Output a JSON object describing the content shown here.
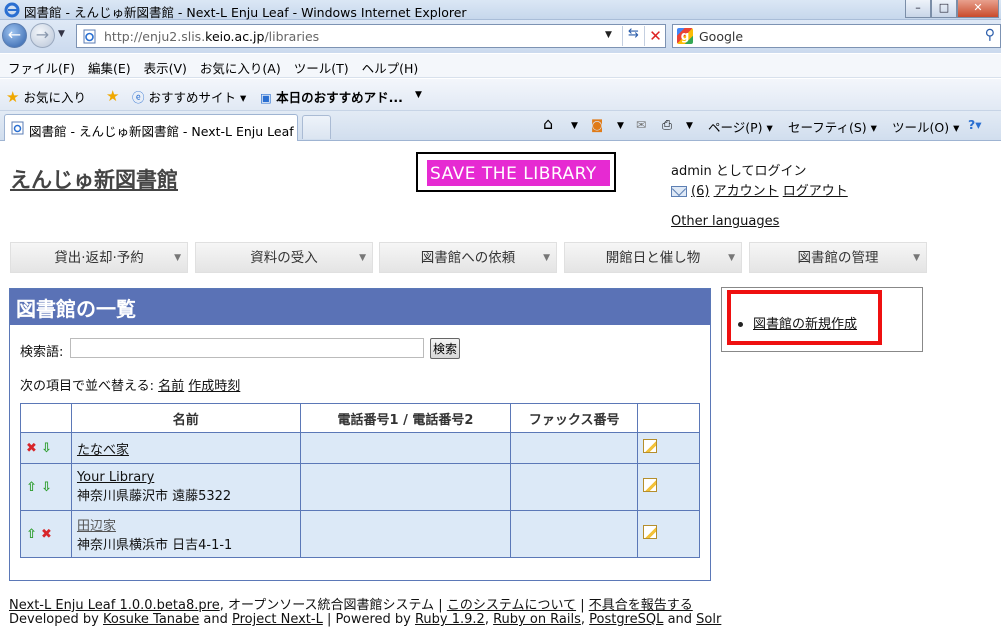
{
  "browser": {
    "window_title": "図書館 - えんじゅ新図書館 - Next-L Enju Leaf - Windows Internet Explorer",
    "url_prefix": "http://enju2.slis.",
    "url_host": "keio.ac.jp",
    "url_path": "/libraries",
    "search_provider": "Google",
    "menu": [
      "ファイル(F)",
      "編集(E)",
      "表示(V)",
      "お気に入り(A)",
      "ツール(T)",
      "ヘルプ(H)"
    ],
    "favorites_label": "お気に入り",
    "fav_sites": "おすすめサイト ▾",
    "fav_today": "本日のおすすめアド...",
    "tab_label": "図書館 - えんじゅ新図書館 - Next-L Enju Leaf",
    "cmd_page": "ページ(P) ▾",
    "cmd_safety": "セーフティ(S) ▾",
    "cmd_tools": "ツール(O) ▾"
  },
  "site": {
    "title": "えんじゅ新図書館",
    "banner": "SAVE THE LIBRARY",
    "login_text": "admin としてログイン",
    "messages": "(6)",
    "account": "アカウント",
    "logout": "ログアウト",
    "other_languages": "Other languages"
  },
  "nav": [
    {
      "label": "貸出·返却·予約"
    },
    {
      "label": "資料の受入"
    },
    {
      "label": "図書館への依頼"
    },
    {
      "label": "開館日と催し物"
    },
    {
      "label": "図書館の管理"
    }
  ],
  "main": {
    "heading": "図書館の一覧",
    "search_label": "検索語:",
    "search_value": "",
    "search_button": "検索",
    "sort_prefix": "次の項目で並べ替える:",
    "sort_name": "名前",
    "sort_created": "作成時刻",
    "columns": [
      "",
      "名前",
      "電話番号1 / 電話番号2",
      "ファックス番号",
      ""
    ],
    "rows": [
      {
        "controls": "✖ ⇩",
        "name": "たなべ家",
        "address": "",
        "phone": "",
        "fax": ""
      },
      {
        "controls": "⇧ ⇩",
        "name": "Your Library",
        "address": "神奈川県藤沢市 遠藤5322",
        "phone": "",
        "fax": ""
      },
      {
        "controls": "⇧ ✖",
        "name": "田辺家",
        "address": "神奈川県横浜市 日吉4-1-1",
        "phone": "",
        "fax": ""
      }
    ]
  },
  "sidebar": {
    "new_library": "図書館の新規作成"
  },
  "footer": {
    "product": "Next-L Enju Leaf 1.0.0.beta8.pre",
    "product_desc": ", オープンソース統合図書館システム |",
    "about": "このシステムについて",
    "sep": "|",
    "report": "不具合を報告する",
    "developed_by": "Developed by",
    "author": "Kosuke Tanabe",
    "and1": "and",
    "project": "Project Next-L",
    "powered": "| Powered by",
    "ruby": "Ruby 1.9.2",
    "rails": "Ruby on Rails",
    "postgres": "PostgreSQL",
    "and2": "and",
    "solr": "Solr"
  },
  "colors": {
    "heading_bg": "#5a72b6",
    "table_row_bg": "#dce9f7",
    "highlight_red": "#ef1010",
    "banner_pink": "#e62ad2"
  }
}
